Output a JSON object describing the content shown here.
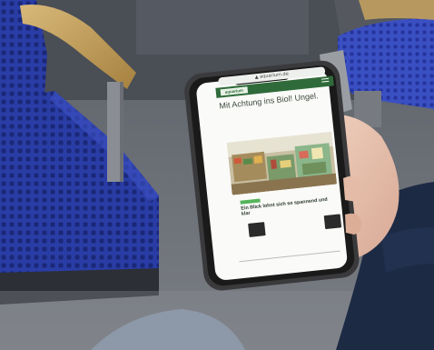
{
  "scene": {
    "description_hidden": false,
    "colors": {
      "seat_blue": "#2b3fa8",
      "armrest_wood": "#c9a560",
      "phone_frame": "#2a2a2a",
      "site_green": "#2f6b3a",
      "accent_green": "#55b45a"
    }
  },
  "phone": {
    "url_text": "▲ aquarium.de",
    "logo_text": "aquarium",
    "headline": "Mit Achtung ins Biol! Ungel.",
    "caption": "Ein Blick lohnt sich so spannend und klar",
    "icons": [
      "menu-icon"
    ]
  }
}
